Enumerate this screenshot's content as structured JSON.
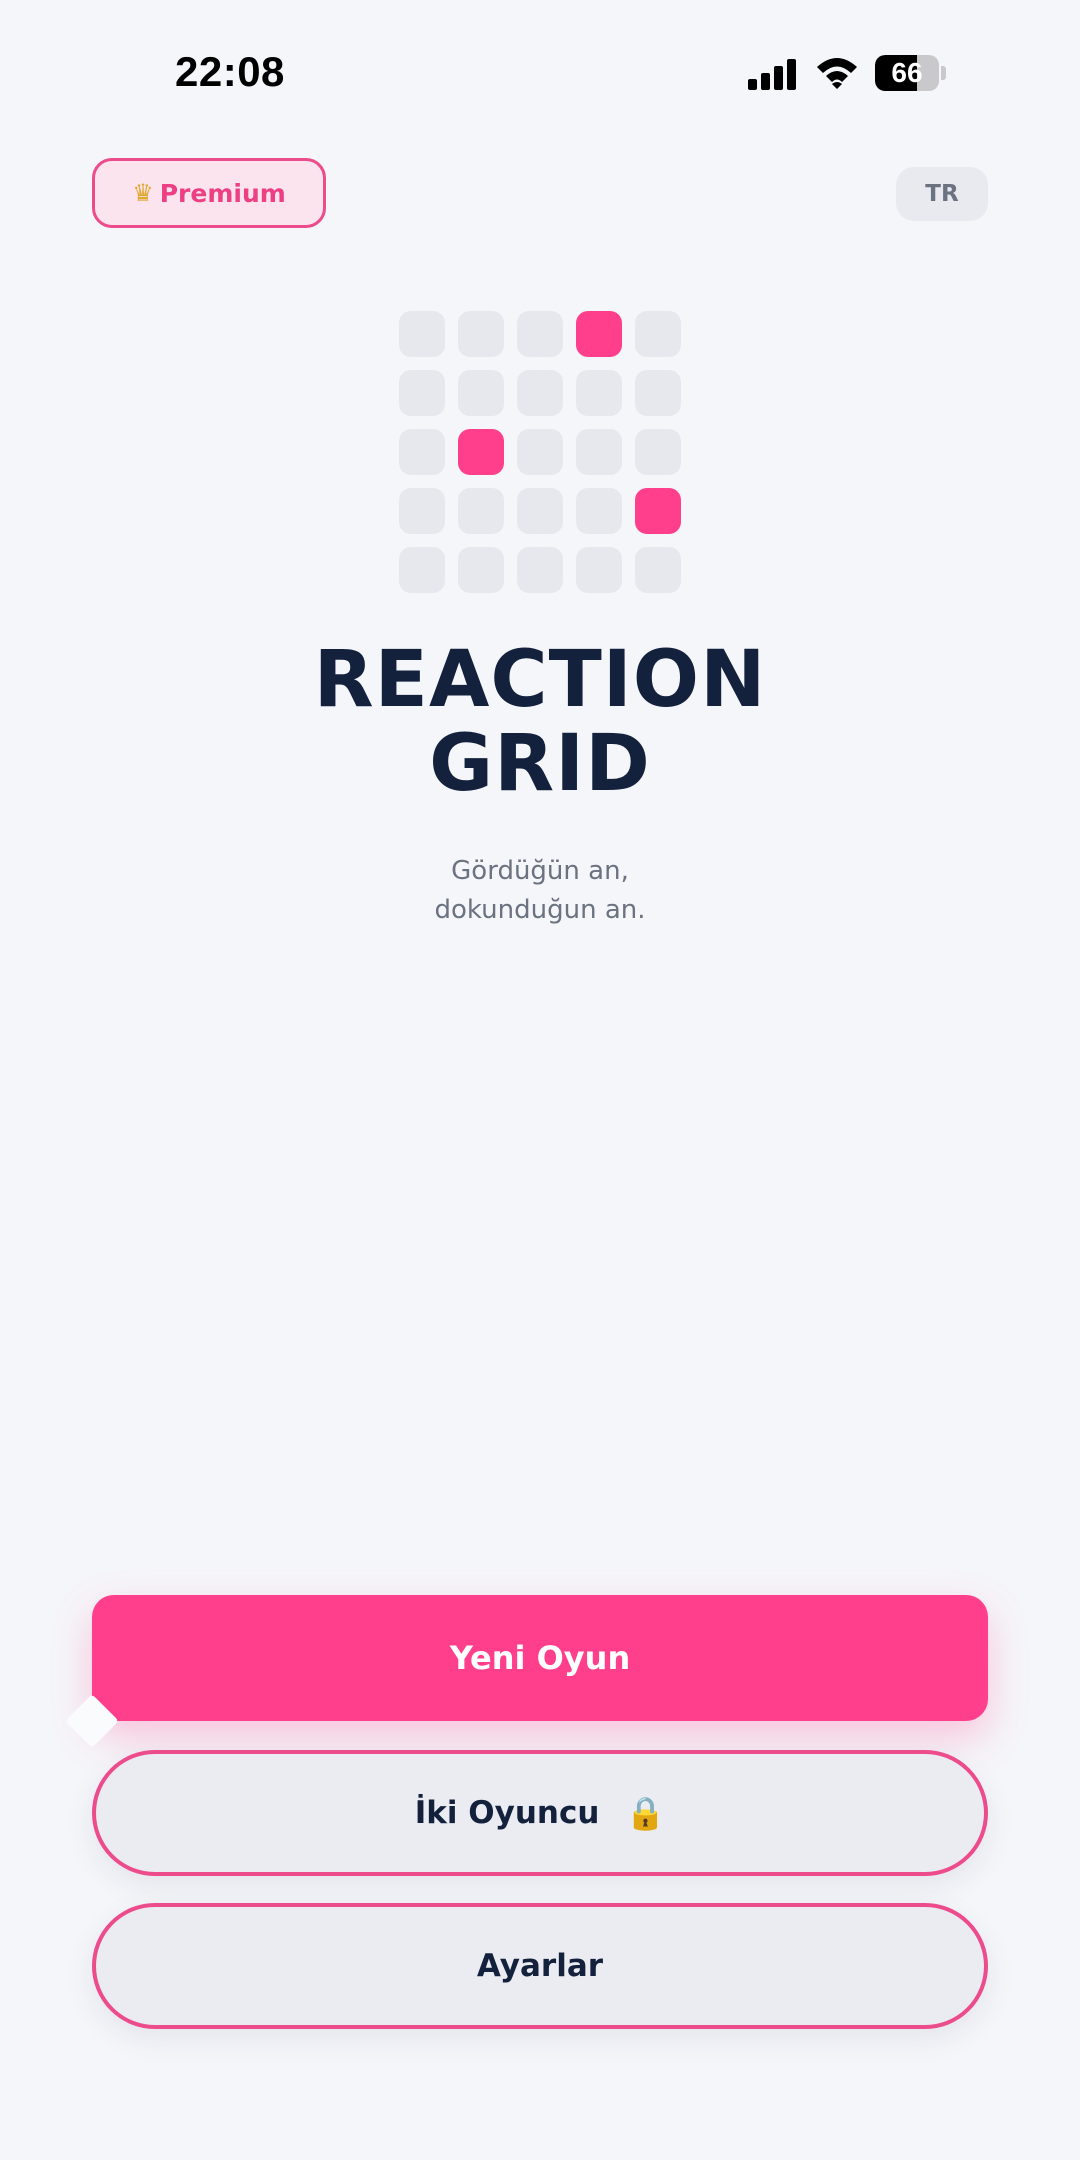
{
  "status_bar": {
    "time": "22:08",
    "battery": "66",
    "battery_level": 0.66
  },
  "header": {
    "premium_label": "Premium",
    "language": "TR"
  },
  "logo": {
    "rows": 5,
    "cols": 5,
    "active_cells": [
      [
        0,
        3
      ],
      [
        2,
        1
      ],
      [
        3,
        4
      ]
    ],
    "active_color": "#ff3f8b",
    "inactive_color": "#e6e8ee"
  },
  "title": {
    "line1": "REACTION",
    "line2": "GRID"
  },
  "tagline": {
    "line1": "Gördüğün an,",
    "line2": "dokunduğun an."
  },
  "menu": {
    "new_game": "Yeni Oyun",
    "two_player": "İki Oyuncu",
    "settings": "Ayarlar"
  },
  "colors": {
    "accent": "#ff3f8b",
    "text": "#14213d",
    "background": "#f5f6fa"
  },
  "icons": [
    "cellular-signal-icon",
    "wifi-icon",
    "battery-icon",
    "crown-icon",
    "lock-icon"
  ]
}
